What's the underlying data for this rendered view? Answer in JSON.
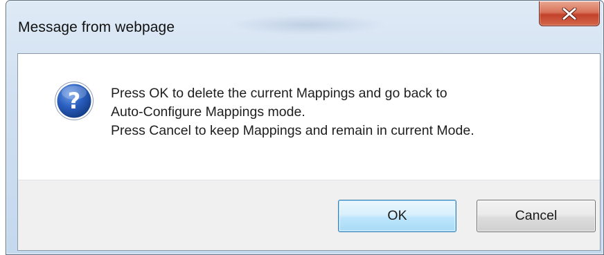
{
  "dialog": {
    "title": "Message from webpage",
    "close_icon": "close-icon",
    "message_icon": "question-icon",
    "message_lines": [
      "Press OK to delete the current Mappings and go back to",
      "Auto-Configure Mappings mode.",
      "Press Cancel to keep Mappings and remain in current Mode."
    ],
    "buttons": {
      "ok_label": "OK",
      "cancel_label": "Cancel"
    }
  },
  "colors": {
    "titlebar": "#cfdff1",
    "close_button": "#c94a30",
    "question_icon": "#1f4fa8",
    "ok_button_border": "#3c7fb1",
    "button_area": "#f0f0f0"
  }
}
